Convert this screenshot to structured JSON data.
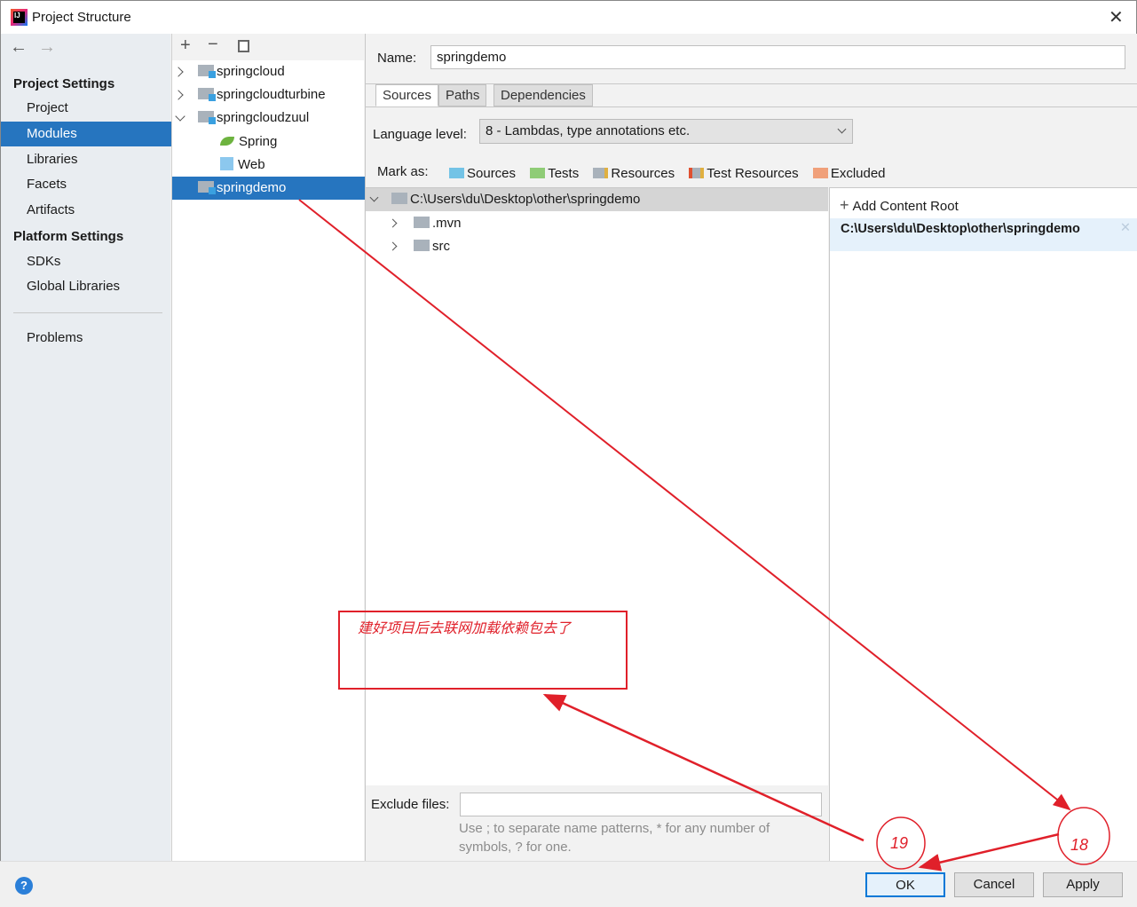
{
  "window": {
    "title": "Project Structure"
  },
  "sidebar": {
    "project_settings": "Project Settings",
    "items": [
      "Project",
      "Modules",
      "Libraries",
      "Facets",
      "Artifacts"
    ],
    "platform_settings": "Platform Settings",
    "platform_items": [
      "SDKs",
      "Global Libraries"
    ],
    "problems": "Problems",
    "selected": "Modules"
  },
  "modules": {
    "items": [
      {
        "label": "springcloud",
        "expanded": false
      },
      {
        "label": "springcloudturbine",
        "expanded": false
      },
      {
        "label": "springcloudzuul",
        "expanded": true
      },
      {
        "label": "Spring",
        "icon": "spring-leaf-icon"
      },
      {
        "label": "Web",
        "icon": "web-facet-icon"
      },
      {
        "label": "springdemo",
        "selected": true
      }
    ]
  },
  "detail": {
    "name_label": "Name:",
    "name_value": "springdemo",
    "tabs": [
      "Sources",
      "Paths",
      "Dependencies"
    ],
    "active_tab": "Sources",
    "language_label": "Language level:",
    "language_value": "8 - Lambdas, type annotations etc.",
    "mark_as": "Mark as:",
    "marks": [
      {
        "label": "Sources",
        "color": "#73c3e6"
      },
      {
        "label": "Tests",
        "color": "#8fcc76"
      },
      {
        "label": "Resources",
        "color": "#a9b2bb"
      },
      {
        "label": "Test Resources",
        "color": "#a9b2bb"
      },
      {
        "label": "Excluded",
        "color": "#f0a07a"
      }
    ],
    "root_path": "C:\\Users\\du\\Desktop\\other\\springdemo",
    "children": [
      ".mvn",
      "src"
    ],
    "add_content_root": "Add Content Root",
    "content_root": "C:\\Users\\du\\Desktop\\other\\springdemo",
    "exclude_label": "Exclude files:",
    "exclude_value": "",
    "exclude_hint_1": "Use ; to separate name patterns, * for any number of",
    "exclude_hint_2": "symbols, ? for one."
  },
  "footer": {
    "ok": "OK",
    "cancel": "Cancel",
    "apply": "Apply"
  },
  "annotations": {
    "note": "建好项目后去联网加载依赖包去了",
    "step_a": "19",
    "step_b": "18",
    "color": "#e0202a"
  }
}
